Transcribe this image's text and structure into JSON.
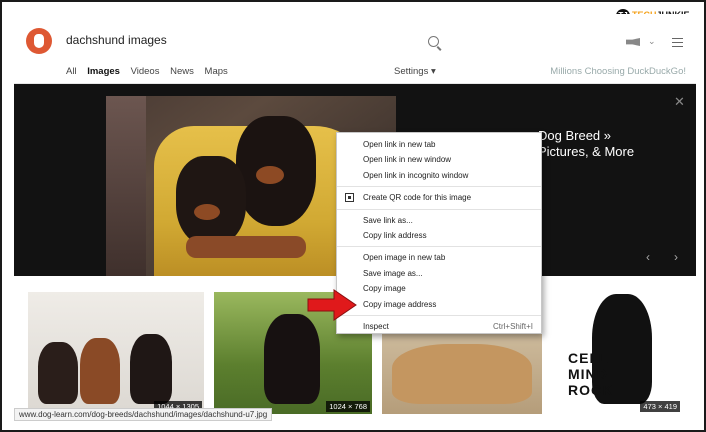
{
  "header": {
    "search_query": "dachshund images",
    "tabs": [
      "All",
      "Images",
      "Videos",
      "News",
      "Maps"
    ],
    "settings_label": "Settings",
    "promo_text": "Millions Choosing DuckDuckGo!"
  },
  "watermark_top": {
    "mark": "TJ",
    "brand_prefix": "TECH",
    "brand_suffix": "JUNKIE"
  },
  "hero": {
    "side_title_line1": "Dog Breed »",
    "side_title_line2": "Pictures, & More"
  },
  "thumbnails": [
    {
      "badge": "1044 × 1305"
    },
    {
      "badge": "1024 × 768"
    },
    {
      "badge": ""
    },
    {
      "badge": "473 × 419"
    }
  ],
  "context_menu": {
    "group1": [
      "Open link in new tab",
      "Open link in new window",
      "Open link in incognito window"
    ],
    "qr": "Create QR code for this image",
    "group2": [
      "Save link as...",
      "Copy link address"
    ],
    "group3": [
      "Open image in new tab",
      "Save image as...",
      "Copy image",
      "Copy image address"
    ],
    "inspect": {
      "label": "Inspect",
      "shortcut": "Ctrl+Shift+I"
    }
  },
  "status_url": "www.dog-learn.com/dog-breeds/dachshund/images/dachshund-u7.jpg",
  "watermark_bottom": [
    "CELL",
    "MIND",
    "ROCK"
  ],
  "colors": {
    "ddg_orange": "#de5833",
    "arrow_red": "#e0191b",
    "brand_orange": "#f4a21b"
  }
}
